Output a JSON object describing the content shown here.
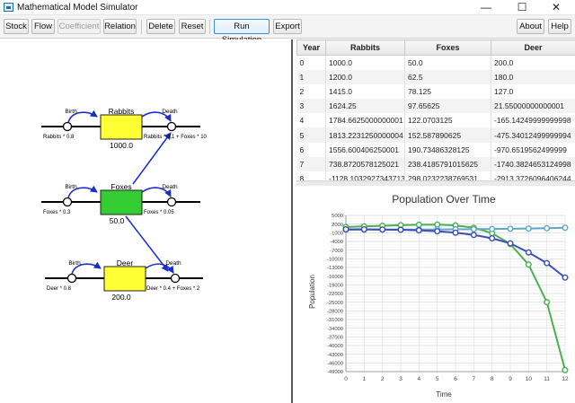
{
  "window": {
    "title": "Mathematical Model Simulator",
    "controls": {
      "minimize": "—",
      "maximize": "☐",
      "close": "✕"
    }
  },
  "toolbar": {
    "stock": "Stock",
    "flow": "Flow",
    "coefficient": "Coefficient",
    "relation": "Relation",
    "delete": "Delete",
    "reset": "Reset",
    "run_simulation": "Run Simulation",
    "export": "Export",
    "about": "About",
    "help": "Help"
  },
  "diagram": {
    "stocks": [
      {
        "name": "Rabbits",
        "value": "1000.0",
        "color": "#ffff33"
      },
      {
        "name": "Foxes",
        "value": "50.0",
        "color": "#33cc33"
      },
      {
        "name": "Deer",
        "value": "200.0",
        "color": "#ffff33"
      }
    ],
    "flows": [
      {
        "label": "Birth",
        "formula": "Rabbits * 0.8"
      },
      {
        "label": "Death",
        "formula": "Rabbits * 0.1 + Foxes * 10"
      },
      {
        "label": "Birth",
        "formula": "Foxes * 0.3"
      },
      {
        "label": "Death",
        "formula": "Foxes * 0.05"
      },
      {
        "label": "Birth",
        "formula": "Deer * 0.8"
      },
      {
        "label": "Death",
        "formula": "Deer * 0.4 + Foxes * 2"
      }
    ],
    "relation_color": "#1a2ec8"
  },
  "table": {
    "headers": [
      "Year",
      "Rabbits",
      "Foxes",
      "Deer"
    ],
    "rows": [
      [
        "0",
        "1000.0",
        "50.0",
        "200.0"
      ],
      [
        "1",
        "1200.0",
        "62.5",
        "180.0"
      ],
      [
        "2",
        "1415.0",
        "78.125",
        "127.0"
      ],
      [
        "3",
        "1624.25",
        "97.65625",
        "21.55000000000001"
      ],
      [
        "4",
        "1784.6625000000001",
        "122.0703125",
        "-165.14249999999998"
      ],
      [
        "5",
        "1813.2231250000004",
        "152.587890625",
        "-475.34012499999994"
      ],
      [
        "6",
        "1556.600406250001",
        "190.73486328125",
        "-970.6519562499999"
      ],
      [
        "7",
        "738.8720578125021",
        "238.4185791015625",
        "-1740.3824653124998"
      ],
      [
        "8",
        "-1128.1032927343713",
        "298.0232238769531",
        "-2913.3726096406244"
      ],
      [
        "9",
        "-4903.3879021484375",
        "372.52902984619",
        "-4671.2312890625"
      ]
    ]
  },
  "chart_data": {
    "type": "line",
    "title": "Population Over Time",
    "xlabel": "Time",
    "ylabel": "Population",
    "xlim": [
      0,
      12
    ],
    "ylim": [
      -49000,
      5000
    ],
    "x_ticks": [
      0,
      1,
      2,
      3,
      4,
      5,
      6,
      7,
      8,
      9,
      10,
      11,
      12
    ],
    "y_ticks": [
      5000,
      2000,
      -1000,
      -4000,
      -7000,
      -10000,
      -13000,
      -16000,
      -19000,
      -22000,
      -25000,
      -28000,
      -31000,
      -34000,
      -37000,
      -40000,
      -43000,
      -46000,
      -49000
    ],
    "grid": true,
    "x": [
      0,
      1,
      2,
      3,
      4,
      5,
      6,
      7,
      8,
      9,
      10,
      11,
      12
    ],
    "series": [
      {
        "color": "#4caf50",
        "values": [
          1000,
          1200,
          1415,
          1624,
          1785,
          1813,
          1557,
          739,
          -1128,
          -4903,
          -12000,
          -25000,
          -48500
        ]
      },
      {
        "color": "#5ea8c8",
        "values": [
          50,
          62,
          78,
          98,
          122,
          153,
          191,
          238,
          298,
          373,
          466,
          582,
          728
        ]
      },
      {
        "color": "#3b4fb8",
        "values": [
          200,
          180,
          127,
          22,
          -165,
          -475,
          -971,
          -1740,
          -2913,
          -4671,
          -7800,
          -11500,
          -16500
        ]
      }
    ]
  }
}
